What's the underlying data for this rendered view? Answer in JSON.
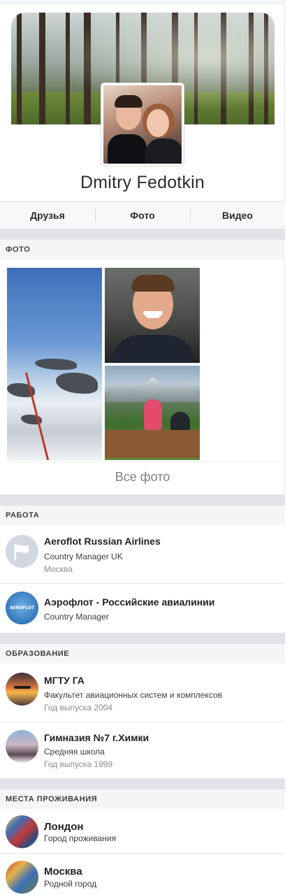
{
  "profile": {
    "name": "Dmitry Fedotkin"
  },
  "tabs": [
    "Друзья",
    "Фото",
    "Видео"
  ],
  "sections": {
    "photos_title": "ФОТО",
    "all_photos_label": "Все фото",
    "work_title": "РАБОТА",
    "education_title": "ОБРАЗОВАНИЕ",
    "places_title": "МЕСТА ПРОЖИВАНИЯ"
  },
  "work": [
    {
      "title": "Aeroflot Russian Airlines",
      "subtitle": "Country Manager UK",
      "meta": "Москва",
      "icon": "flag-icon"
    },
    {
      "title": "Аэрофлот - Российские авиалинии",
      "subtitle": "Country Manager",
      "icon": "aeroflot-logo",
      "logo_text": "AEROFLOT"
    }
  ],
  "education": [
    {
      "title": "МГТУ ГА",
      "subtitle": "Факультет авиационных систем и комплексов",
      "meta": "Год выпуска 2004"
    },
    {
      "title": "Гимназия №7 г.Химки",
      "subtitle": "Средняя школа",
      "meta": "Год выпуска 1999"
    }
  ],
  "places": [
    {
      "title": "Лондон",
      "subtitle": "Город проживания"
    },
    {
      "title": "Москва",
      "subtitle": "Родной город"
    }
  ],
  "colors": {
    "section_gap": "#e1e3e6",
    "section_header_bg": "#f4f5f7",
    "text_primary": "#2c2d2e",
    "text_secondary": "#8a8d92"
  }
}
